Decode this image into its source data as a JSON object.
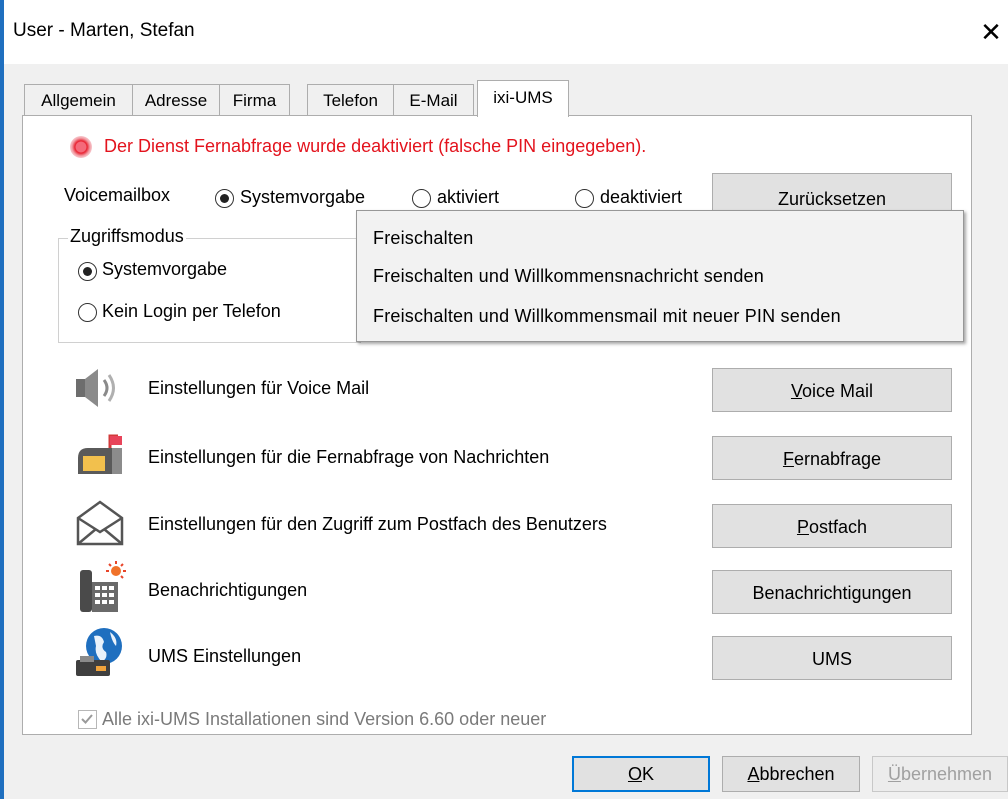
{
  "window": {
    "title": "User - Marten, Stefan",
    "close_glyph": "✕"
  },
  "tabs": [
    {
      "label": "Allgemein",
      "active": false
    },
    {
      "label": "Adresse",
      "active": false
    },
    {
      "label": "Firma",
      "active": false
    },
    {
      "label": "Telefon",
      "active": false
    },
    {
      "label": "E-Mail",
      "active": false
    },
    {
      "label": "ixi-UMS",
      "active": true
    }
  ],
  "warning": {
    "text": "Der Dienst Fernabfrage wurde deaktiviert (falsche PIN eingegeben).",
    "color": "#e3131d"
  },
  "voicemailbox": {
    "label": "Voicemailbox",
    "options": [
      {
        "label": "Systemvorgabe",
        "checked": true
      },
      {
        "label": "aktiviert",
        "checked": false
      },
      {
        "label": "deaktiviert",
        "checked": false
      }
    ],
    "reset_button": "Zurücksetzen"
  },
  "zugriffsmodus": {
    "title": "Zugriffsmodus",
    "options": [
      {
        "label": "Systemvorgabe",
        "checked": true
      },
      {
        "label": "Kein Login per Telefon",
        "checked": false
      }
    ]
  },
  "popup_menu": {
    "items": [
      "Freischalten",
      "Freischalten und Willkommensnachricht senden",
      "Freischalten und Willkommensmail mit neuer PIN senden"
    ]
  },
  "settings_rows": [
    {
      "icon": "speaker-icon",
      "label": "Einstellungen für Voice Mail",
      "button_mnemonic": "V",
      "button_rest": "oice Mail"
    },
    {
      "icon": "mailbox-icon",
      "label": "Einstellungen für die Fernabfrage von Nachrichten",
      "button_mnemonic": "F",
      "button_rest": "ernabfrage"
    },
    {
      "icon": "envelope-icon",
      "label": "Einstellungen für den Zugriff zum Postfach des Benutzers",
      "button_mnemonic": "P",
      "button_rest": "ostfach"
    },
    {
      "icon": "phone-alert-icon",
      "label": "Benachrichtigungen",
      "button_mnemonic": "",
      "button_rest": "Benachrichtigungen"
    },
    {
      "icon": "globe-fax-icon",
      "label": "UMS Einstellungen",
      "button_mnemonic": "",
      "button_rest": "UMS"
    }
  ],
  "version_checkbox": {
    "label": "Alle ixi-UMS Installationen sind Version 6.60 oder neuer",
    "checked": true,
    "disabled": true
  },
  "footer_buttons": {
    "ok_mnemonic": "O",
    "ok_rest": "K",
    "cancel_mnemonic": "A",
    "cancel_rest": "bbrechen",
    "apply_mnemonic": "Ü",
    "apply_rest": "bernehmen"
  },
  "colors": {
    "accent": "#0078d7",
    "window_border": "#1f6fbf"
  }
}
